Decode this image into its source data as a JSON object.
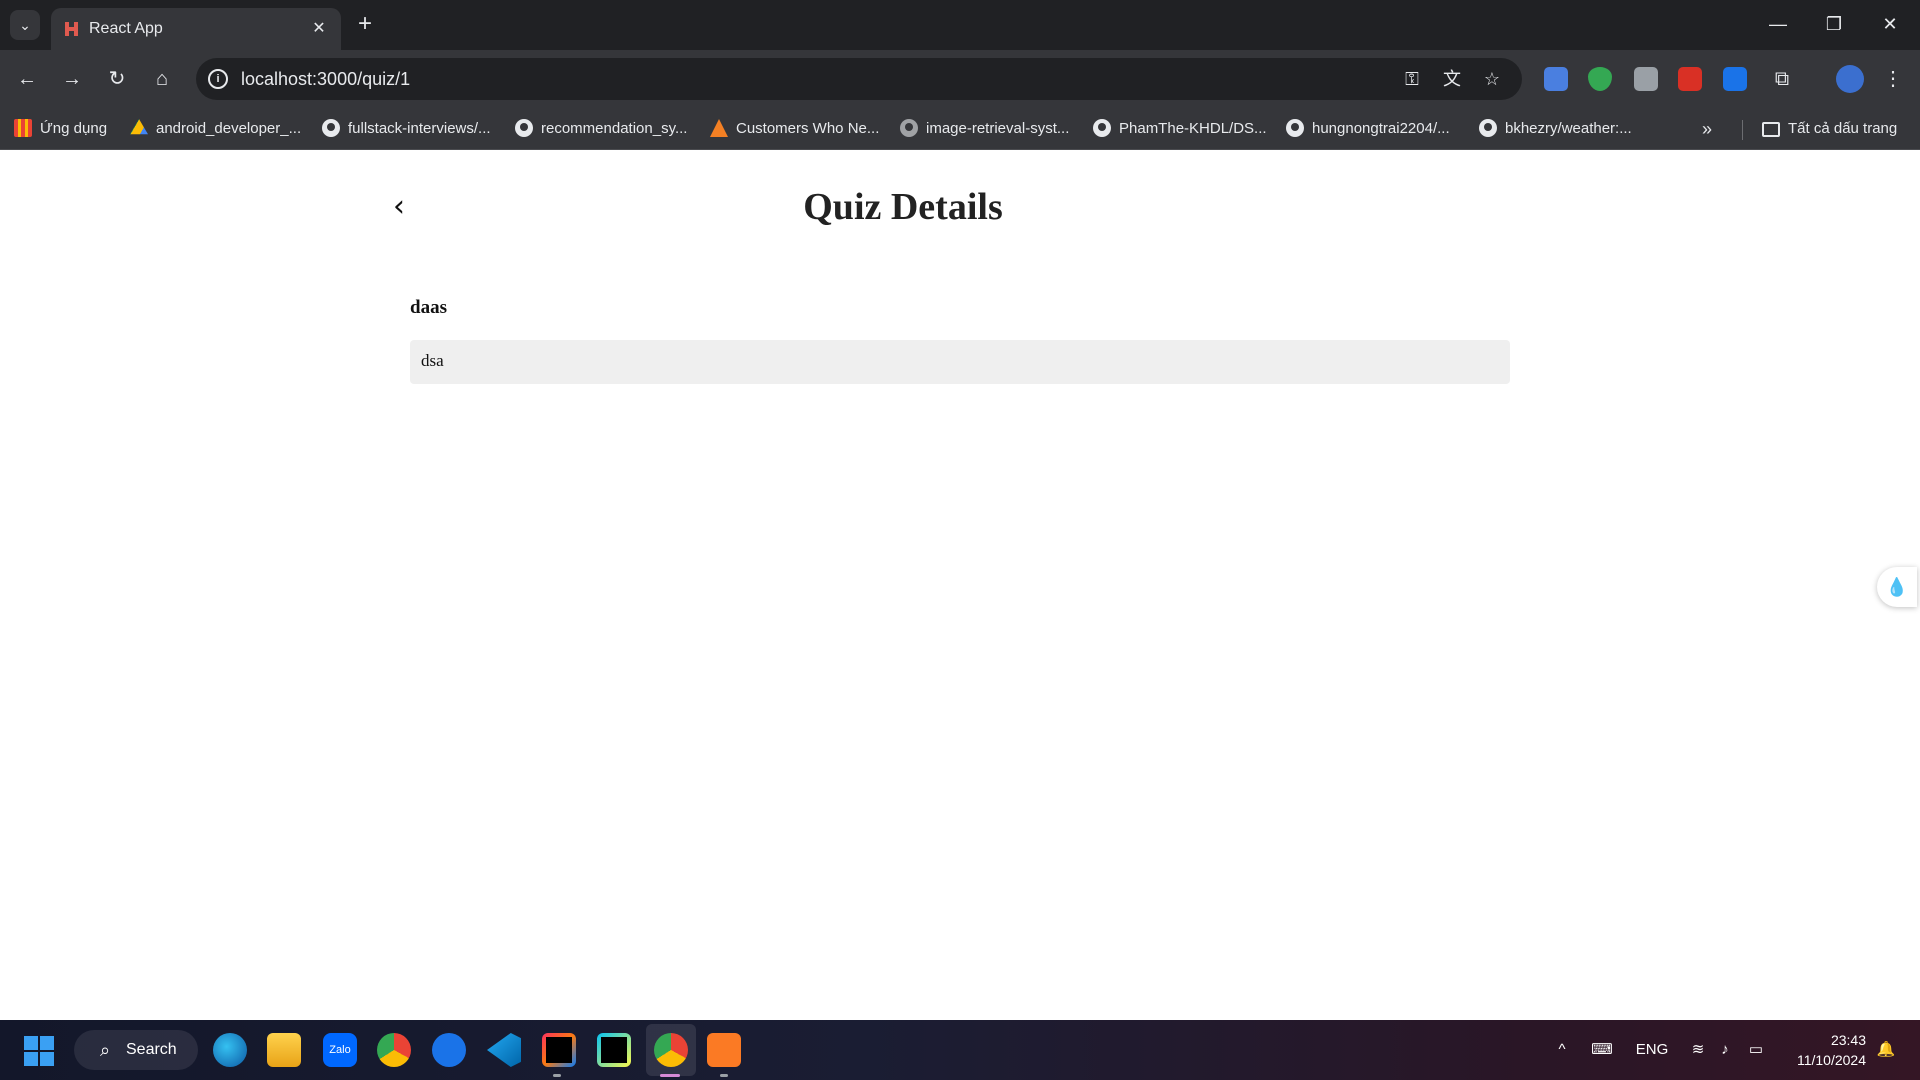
{
  "browser": {
    "tab": {
      "title": "React App"
    },
    "address_bar": {
      "url": "localhost:3000/quiz/1"
    },
    "bookmarks": [
      {
        "label": "Ứng dụng",
        "icon": "apps-grid-icon"
      },
      {
        "label": "android_developer_...",
        "icon": "google-drive-icon"
      },
      {
        "label": "fullstack-interviews/...",
        "icon": "github-icon"
      },
      {
        "label": "recommendation_sy...",
        "icon": "github-icon"
      },
      {
        "label": "Customers Who Ne...",
        "icon": "site-favicon-icon"
      },
      {
        "label": "image-retrieval-syst...",
        "icon": "github-icon"
      },
      {
        "label": "PhamThe-KHDL/DS...",
        "icon": "github-icon"
      },
      {
        "label": "hungnongtrai2204/...",
        "icon": "github-icon"
      },
      {
        "label": "bkhezry/weather:...",
        "icon": "github-icon"
      }
    ],
    "all_bookmarks_label": "Tất cả dấu trang"
  },
  "page": {
    "title": "Quiz Details",
    "question": "daas",
    "answers": [
      "dsa"
    ]
  },
  "taskbar": {
    "search_label": "Search",
    "language": "ENG",
    "time": "23:43",
    "date": "11/10/2024"
  },
  "colors": {
    "chrome_dark": "#202124",
    "chrome_toolbar": "#35363a",
    "answer_bg": "#efefef"
  }
}
